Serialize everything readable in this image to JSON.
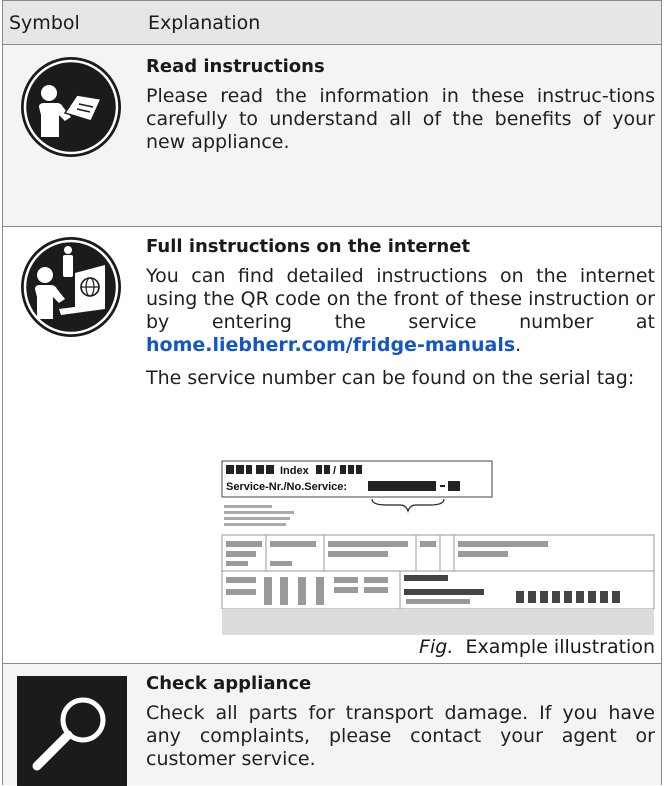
{
  "table": {
    "header": {
      "symbol": "Symbol",
      "explanation": "Explanation"
    },
    "rows": [
      {
        "icon": "person-reading-book-icon",
        "title": "Read instructions",
        "text": "Please read the information in these instruc-tions carefully to understand all of the benefits of your new appliance."
      },
      {
        "icon": "person-info-laptop-icon",
        "title": "Full instructions on the internet",
        "text_before_link": "You can find detailed instructions on the internet using the QR code on the front of these instruction or by entering the service number at",
        "link": "home.liebherr.com/fridge-manuals",
        "text_after_link": ".",
        "text2": "The service number can be found on the serial tag:",
        "figure": {
          "tag_line1": "Index",
          "tag_line1_suffix": "/",
          "tag_line2": "Service-Nr./No.Service:",
          "caption_label": "Fig.",
          "caption_text": "Example illustration"
        }
      },
      {
        "icon": "magnifier-icon",
        "title": "Check appliance",
        "text": "Check all parts for transport damage. If you have any complaints, please contact your agent or customer service."
      }
    ]
  },
  "colors": {
    "link": "#1556c7",
    "header_bg": "#e6e6e6",
    "row_alt_bg": "#f4f4f4",
    "icon_dark": "#1b1b1b"
  }
}
